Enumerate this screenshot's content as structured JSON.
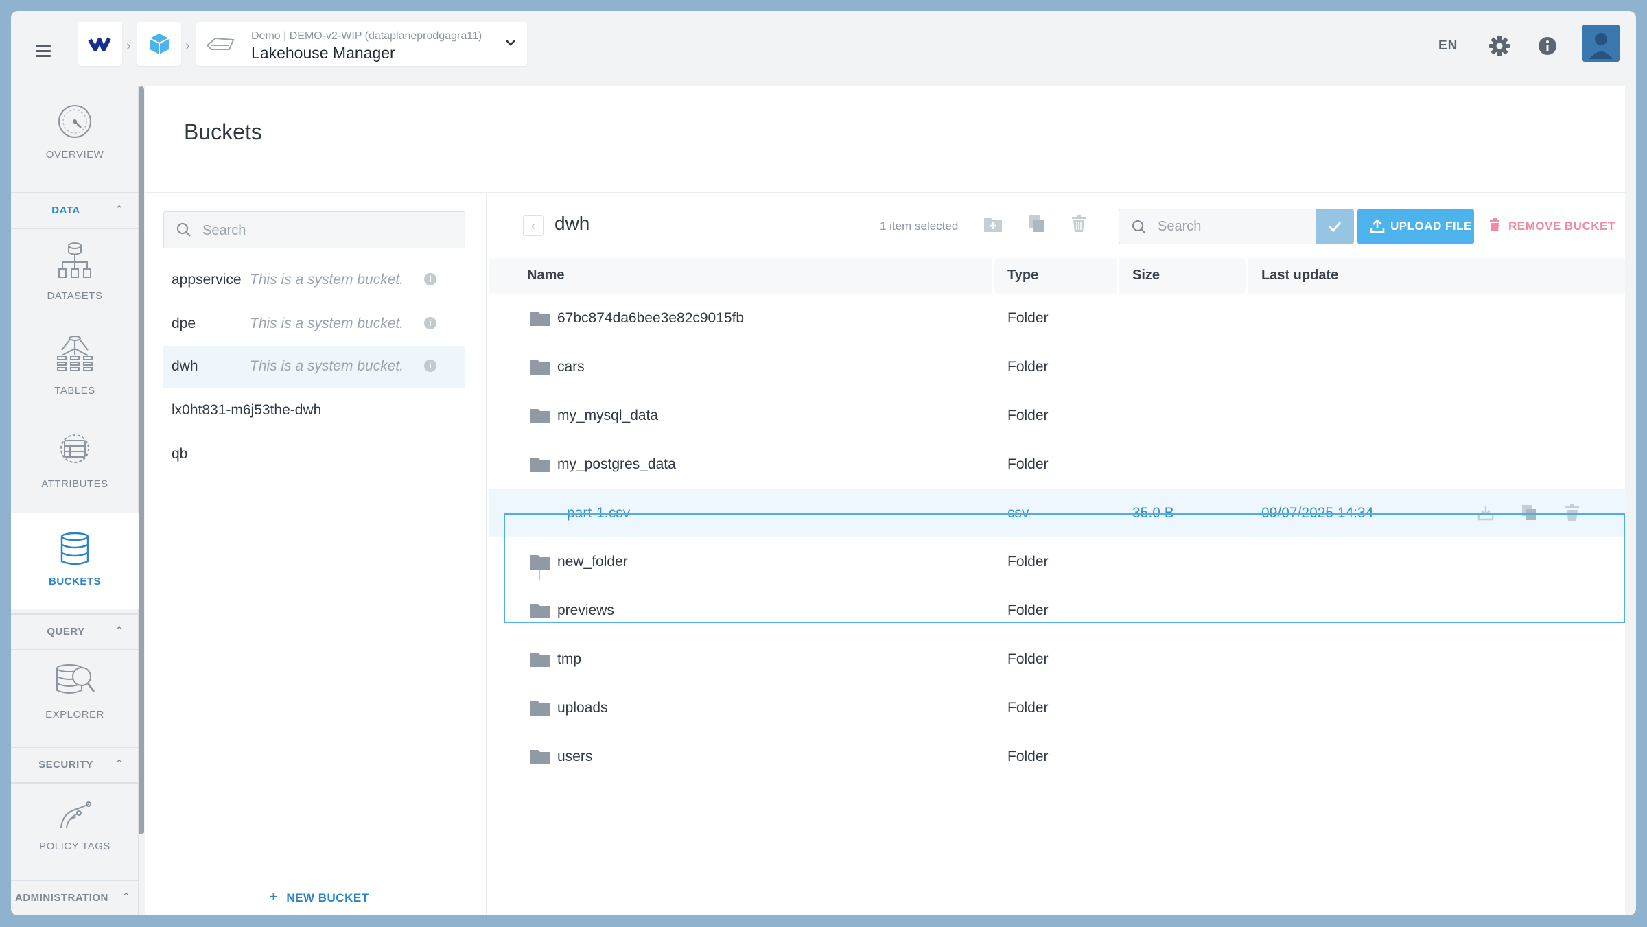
{
  "topbar": {
    "app_subtitle": "Demo | DEMO-v2-WIP (dataplaneprodgagra11)",
    "app_title": "Lakehouse Manager",
    "language": "EN"
  },
  "leftnav": {
    "overview": "OVERVIEW",
    "section_data": "DATA",
    "datasets": "DATASETS",
    "tables": "TABLES",
    "attributes": "ATTRIBUTES",
    "buckets": "BUCKETS",
    "section_query": "QUERY",
    "explorer": "EXPLORER",
    "section_security": "SECURITY",
    "policy_tags": "POLICY TAGS",
    "section_admin": "ADMINISTRATION"
  },
  "page": {
    "title": "Buckets"
  },
  "buckets": {
    "search_placeholder": "Search",
    "items": [
      {
        "name": "appservice",
        "desc": "This is a system bucket."
      },
      {
        "name": "dpe",
        "desc": "This is a system bucket."
      },
      {
        "name": "dwh",
        "desc": "This is a system bucket."
      },
      {
        "name": "lx0ht831-m6j53the-dwh",
        "desc": ""
      },
      {
        "name": "qb",
        "desc": ""
      }
    ],
    "new_bucket": "NEW BUCKET"
  },
  "files": {
    "current": "dwh",
    "selected_count": "1 item selected",
    "search_placeholder": "Search",
    "upload_label": "UPLOAD FILE",
    "remove_label": "REMOVE BUCKET",
    "columns": {
      "name": "Name",
      "type": "Type",
      "size": "Size",
      "last_update": "Last update"
    },
    "rows": [
      {
        "name": "67bc874da6bee3e82c9015fb",
        "type": "Folder",
        "size": "",
        "date": ""
      },
      {
        "name": "cars",
        "type": "Folder",
        "size": "",
        "date": ""
      },
      {
        "name": "my_mysql_data",
        "type": "Folder",
        "size": "",
        "date": ""
      },
      {
        "name": "my_postgres_data",
        "type": "Folder",
        "size": "",
        "date": ""
      },
      {
        "name": "part-1.csv",
        "type": "csv",
        "size": "35.0 B",
        "date": "09/07/2025 14:34"
      },
      {
        "name": "new_folder",
        "type": "Folder",
        "size": "",
        "date": ""
      },
      {
        "name": "previews",
        "type": "Folder",
        "size": "",
        "date": ""
      },
      {
        "name": "tmp",
        "type": "Folder",
        "size": "",
        "date": ""
      },
      {
        "name": "uploads",
        "type": "Folder",
        "size": "",
        "date": ""
      },
      {
        "name": "users",
        "type": "Folder",
        "size": "",
        "date": ""
      }
    ]
  },
  "colors": {
    "accent": "#2b84c6",
    "upload": "#4db3ec",
    "remove": "#f08aa0",
    "highlight": "#4fb0e0"
  }
}
